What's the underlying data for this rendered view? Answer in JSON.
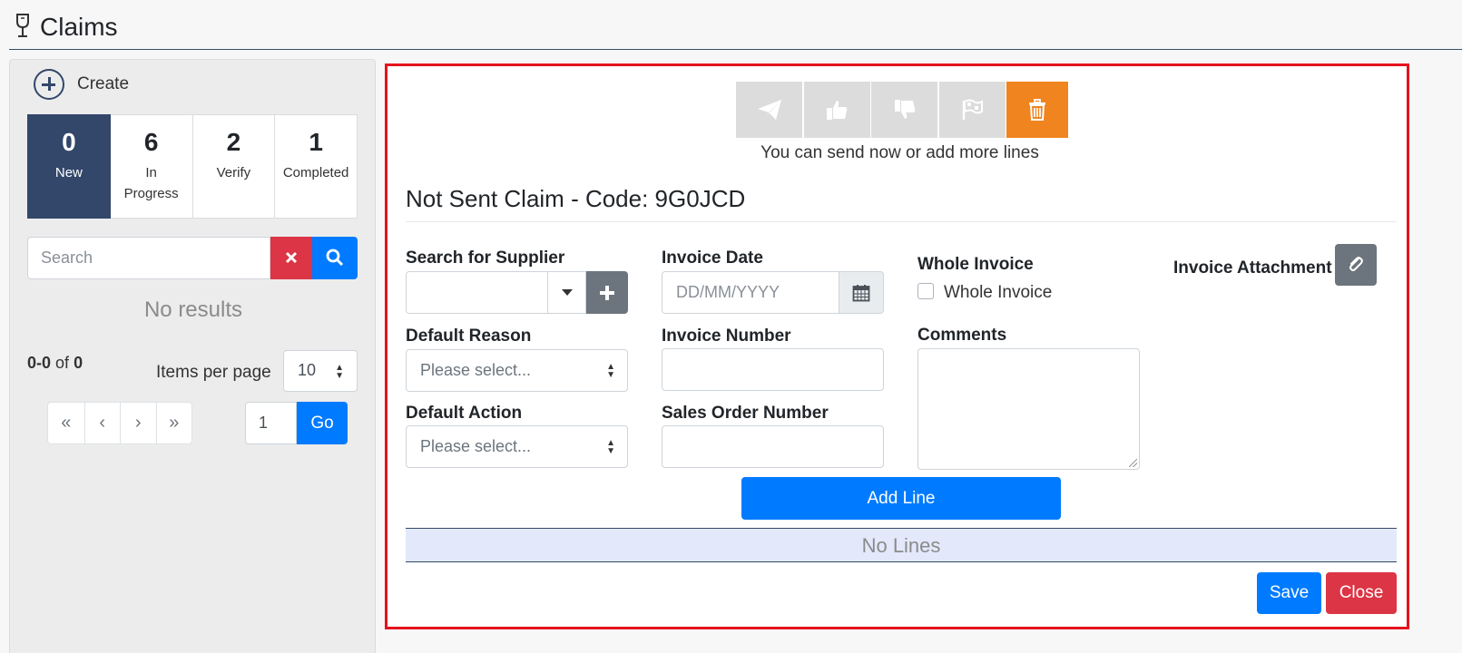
{
  "header": {
    "title": "Claims",
    "icon": "wine-glass-icon"
  },
  "sidebar": {
    "create_label": "Create",
    "status_tabs": [
      {
        "count": "0",
        "label": "New",
        "active": true
      },
      {
        "count": "6",
        "label": "In Progress",
        "active": false
      },
      {
        "count": "2",
        "label": "Verify",
        "active": false
      },
      {
        "count": "1",
        "label": "Completed",
        "active": false
      }
    ],
    "search": {
      "placeholder": "Search",
      "value": ""
    },
    "no_results": "No results",
    "pager": {
      "range": "0-0",
      "of_label": "of",
      "total": "0",
      "items_per_page_label": "Items per page",
      "items_per_page": "10",
      "buttons": [
        "«",
        "‹",
        "›",
        "»"
      ],
      "page_input": "1",
      "go_label": "Go"
    }
  },
  "main": {
    "toolbar": {
      "icons": [
        "send-icon",
        "thumbs-up-icon",
        "thumbs-down-icon",
        "finish-flag-icon",
        "trash-icon"
      ],
      "delete_color": "#f0841f"
    },
    "hint": "You can send now or add more lines",
    "claim_title": "Not Sent Claim - Code: 9G0JCD",
    "form": {
      "supplier_label": "Search for Supplier",
      "invoice_date_label": "Invoice Date",
      "invoice_date_placeholder": "DD/MM/YYYY",
      "whole_invoice_label": "Whole Invoice",
      "whole_invoice_check_label": "Whole Invoice",
      "whole_invoice_checked": false,
      "invoice_attachment_label": "Invoice Attachment",
      "default_reason_label": "Default Reason",
      "default_reason_value": "Please select...",
      "invoice_number_label": "Invoice Number",
      "comments_label": "Comments",
      "default_action_label": "Default Action",
      "default_action_value": "Please select...",
      "sales_order_label": "Sales Order Number"
    },
    "add_line_label": "Add Line",
    "no_lines": "No Lines",
    "save_label": "Save",
    "close_label": "Close"
  },
  "colors": {
    "primary": "#007bff",
    "danger": "#dc3545",
    "navy": "#32476a",
    "secondary": "#6c757d",
    "highlight_border": "#e5131d"
  }
}
